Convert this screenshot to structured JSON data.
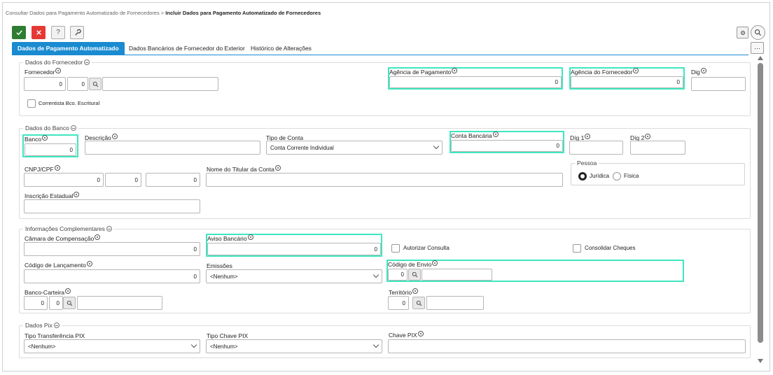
{
  "breadcrumb": {
    "parent": "Consultar Dados para Pagamento Automatizado de Fornecedores",
    "separator": ">",
    "current": "Incluir Dados para Pagamento Automatizado de Fornecedores"
  },
  "toolbar": {
    "confirm_icon": "check-icon",
    "cancel_icon": "close-icon",
    "help_label": "?",
    "tools_icon": "wrench-icon",
    "settings_icon": "gear-icon",
    "search_icon": "search-icon",
    "more_label": "···"
  },
  "tabs": [
    {
      "label": "Dados de Pagamento Automatizado",
      "active": true
    },
    {
      "label": "Dados Bancários de Fornecedor do Exterior",
      "active": false
    },
    {
      "label": "Histórico de Alterações",
      "active": false
    }
  ],
  "fornecedor": {
    "legend": "Dados do Fornecedor",
    "fornecedor_label": "Fornecedor",
    "fornecedor_code1": "0",
    "fornecedor_code2": "0",
    "fornecedor_name": "",
    "correntista_label": "Correntista Bco. Escritural",
    "agencia_pagamento_label": "Agência de Pagamento",
    "agencia_pagamento_value": "0",
    "agencia_fornecedor_label": "Agência do Fornecedor",
    "agencia_fornecedor_value": "0",
    "dig_label": "Dig",
    "dig_value": ""
  },
  "banco": {
    "legend": "Dados do Banco",
    "banco_label": "Banco",
    "banco_value": "0",
    "descricao_label": "Descrição",
    "descricao_value": "",
    "tipo_conta_label": "Tipo de Conta",
    "tipo_conta_value": "Conta Corrente Individual",
    "conta_bancaria_label": "Conta Bancária",
    "conta_bancaria_value": "0",
    "dig1_label": "Díg 1",
    "dig1_value": "",
    "dig2_label": "Díg 2",
    "dig2_value": "",
    "cnpj_label": "CNPJ/CPF",
    "cnpj_1": "0",
    "cnpj_2": "0",
    "cnpj_3": "0",
    "titular_label": "Nome do Titular da Conta",
    "titular_value": "",
    "pessoa_legend": "Pessoa",
    "pessoa_juridica": "Jurídica",
    "pessoa_fisica": "Física",
    "inscricao_label": "Inscrição Estadual",
    "inscricao_value": ""
  },
  "complementares": {
    "legend": "Informações Complementares",
    "camara_label": "Câmara de Compensação",
    "camara_value": "0",
    "aviso_label": "Aviso Bancário",
    "aviso_value": "0",
    "autorizar_label": "Autorizar Consulta",
    "consolidar_label": "Consolidar Cheques",
    "codigo_lancamento_label": "Código de Lançamento",
    "codigo_lancamento_value": "0",
    "emissoes_label": "Emissões",
    "emissoes_value": "<Nenhum>",
    "codigo_envio_label": "Código de Envio",
    "codigo_envio_value": "0",
    "banco_carteira_label": "Banco-Carteira",
    "banco_carteira_1": "0",
    "banco_carteira_2": "0",
    "territorio_label": "Território",
    "territorio_value": "0"
  },
  "pix": {
    "legend": "Dados Pix",
    "tipo_transferencia_label": "Tipo Transferência PIX",
    "tipo_transferencia_value": "<Nenhum>",
    "tipo_chave_label": "Tipo Chave PIX",
    "tipo_chave_value": "<Nenhum>",
    "chave_label": "Chave PIX",
    "chave_value": ""
  },
  "colors": {
    "accent": "#1a8bd0",
    "highlight": "#3ee6c0",
    "confirm": "#2e7d32",
    "cancel": "#e53935"
  }
}
